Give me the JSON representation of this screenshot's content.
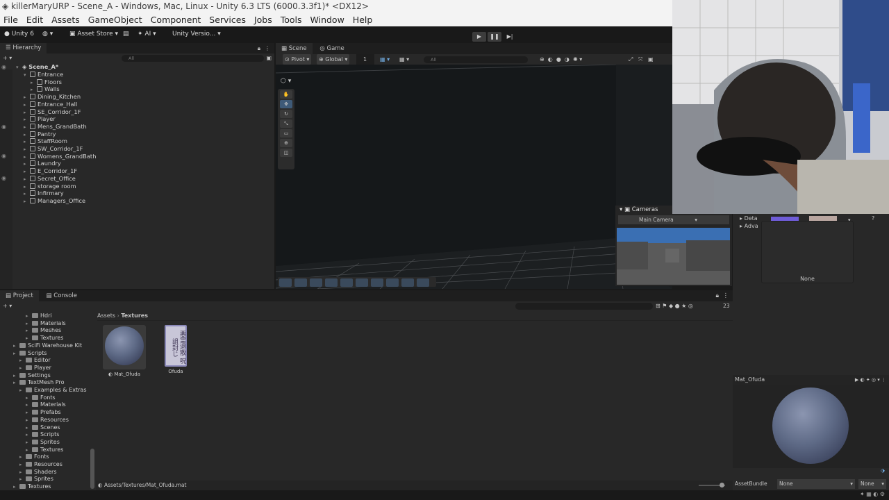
{
  "window": {
    "title": "killerMaryURP - Scene_A - Windows, Mac, Linux - Unity 6.3 LTS (6000.3.3f1)* <DX12>"
  },
  "menu": [
    "File",
    "Edit",
    "Assets",
    "GameObject",
    "Component",
    "Services",
    "Jobs",
    "Tools",
    "Window",
    "Help"
  ],
  "toolbar": {
    "account": "Unity 6",
    "asset_store": "Asset Store",
    "ai": "AI",
    "version_control": "Unity Versio..."
  },
  "hierarchy": {
    "tab": "Hierarchy",
    "search_placeholder": "All",
    "scene": "Scene_A*",
    "items": [
      {
        "label": "Entrance",
        "depth": 1,
        "expanded": true
      },
      {
        "label": "Floors",
        "depth": 2
      },
      {
        "label": "Walls",
        "depth": 2
      },
      {
        "label": "Dining_Kitchen",
        "depth": 1
      },
      {
        "label": "Entrance_Hall",
        "depth": 1
      },
      {
        "label": "SE_Corridor_1F",
        "depth": 1
      },
      {
        "label": "Player",
        "depth": 1
      },
      {
        "label": "Mens_GrandBath",
        "depth": 1
      },
      {
        "label": "Pantry",
        "depth": 1
      },
      {
        "label": "StaffRoom",
        "depth": 1
      },
      {
        "label": "SW_Corridor_1F",
        "depth": 1
      },
      {
        "label": "Womens_GrandBath",
        "depth": 1
      },
      {
        "label": "Laundry",
        "depth": 1
      },
      {
        "label": "E_Corridor_1F",
        "depth": 1
      },
      {
        "label": "Secret_Office",
        "depth": 1
      },
      {
        "label": "storage room",
        "depth": 1
      },
      {
        "label": "Infirmary",
        "depth": 1
      },
      {
        "label": "Managers_Office",
        "depth": 1
      }
    ]
  },
  "scene_view": {
    "tabs": [
      "Scene",
      "Game"
    ],
    "pivot": "Pivot",
    "global": "Global",
    "grid_value": "1",
    "search_placeholder": "All"
  },
  "cameras": {
    "title": "Cameras",
    "selected": "Main Camera"
  },
  "project": {
    "tabs": [
      "Project",
      "Console"
    ],
    "breadcrumb": [
      "Assets",
      "Textures"
    ],
    "count": "23",
    "tree": [
      {
        "label": "Hdri",
        "depth": 3
      },
      {
        "label": "Materials",
        "depth": 3
      },
      {
        "label": "Meshes",
        "depth": 3
      },
      {
        "label": "Textures",
        "depth": 3
      },
      {
        "label": "SciFi Warehouse Kit",
        "depth": 1
      },
      {
        "label": "Scripts",
        "depth": 1
      },
      {
        "label": "Editor",
        "depth": 2
      },
      {
        "label": "Player",
        "depth": 2
      },
      {
        "label": "Settings",
        "depth": 1
      },
      {
        "label": "TextMesh Pro",
        "depth": 1
      },
      {
        "label": "Examples & Extras",
        "depth": 2
      },
      {
        "label": "Fonts",
        "depth": 3
      },
      {
        "label": "Materials",
        "depth": 3
      },
      {
        "label": "Prefabs",
        "depth": 3
      },
      {
        "label": "Resources",
        "depth": 3
      },
      {
        "label": "Scenes",
        "depth": 3
      },
      {
        "label": "Scripts",
        "depth": 3
      },
      {
        "label": "Sprites",
        "depth": 3
      },
      {
        "label": "Textures",
        "depth": 3
      },
      {
        "label": "Fonts",
        "depth": 2
      },
      {
        "label": "Resources",
        "depth": 2
      },
      {
        "label": "Shaders",
        "depth": 2
      },
      {
        "label": "Sprites",
        "depth": 2
      },
      {
        "label": "Textures",
        "depth": 1
      }
    ],
    "assets": [
      {
        "label": "Mat_Ofuda",
        "kind": "material"
      },
      {
        "label": "Ofuda",
        "kind": "texture",
        "texture_text": "悪霊退散 呪詛封じ"
      }
    ],
    "path": "Assets/Textures/Mat_Ofuda.mat"
  },
  "inspector": {
    "rows": [
      "Deta",
      "Adva"
    ],
    "popup_label": "None",
    "preview_title": "Mat_Ofuda",
    "assetbundle_label": "AssetBundle",
    "assetbundle_value": "None",
    "variant_value": "None"
  }
}
